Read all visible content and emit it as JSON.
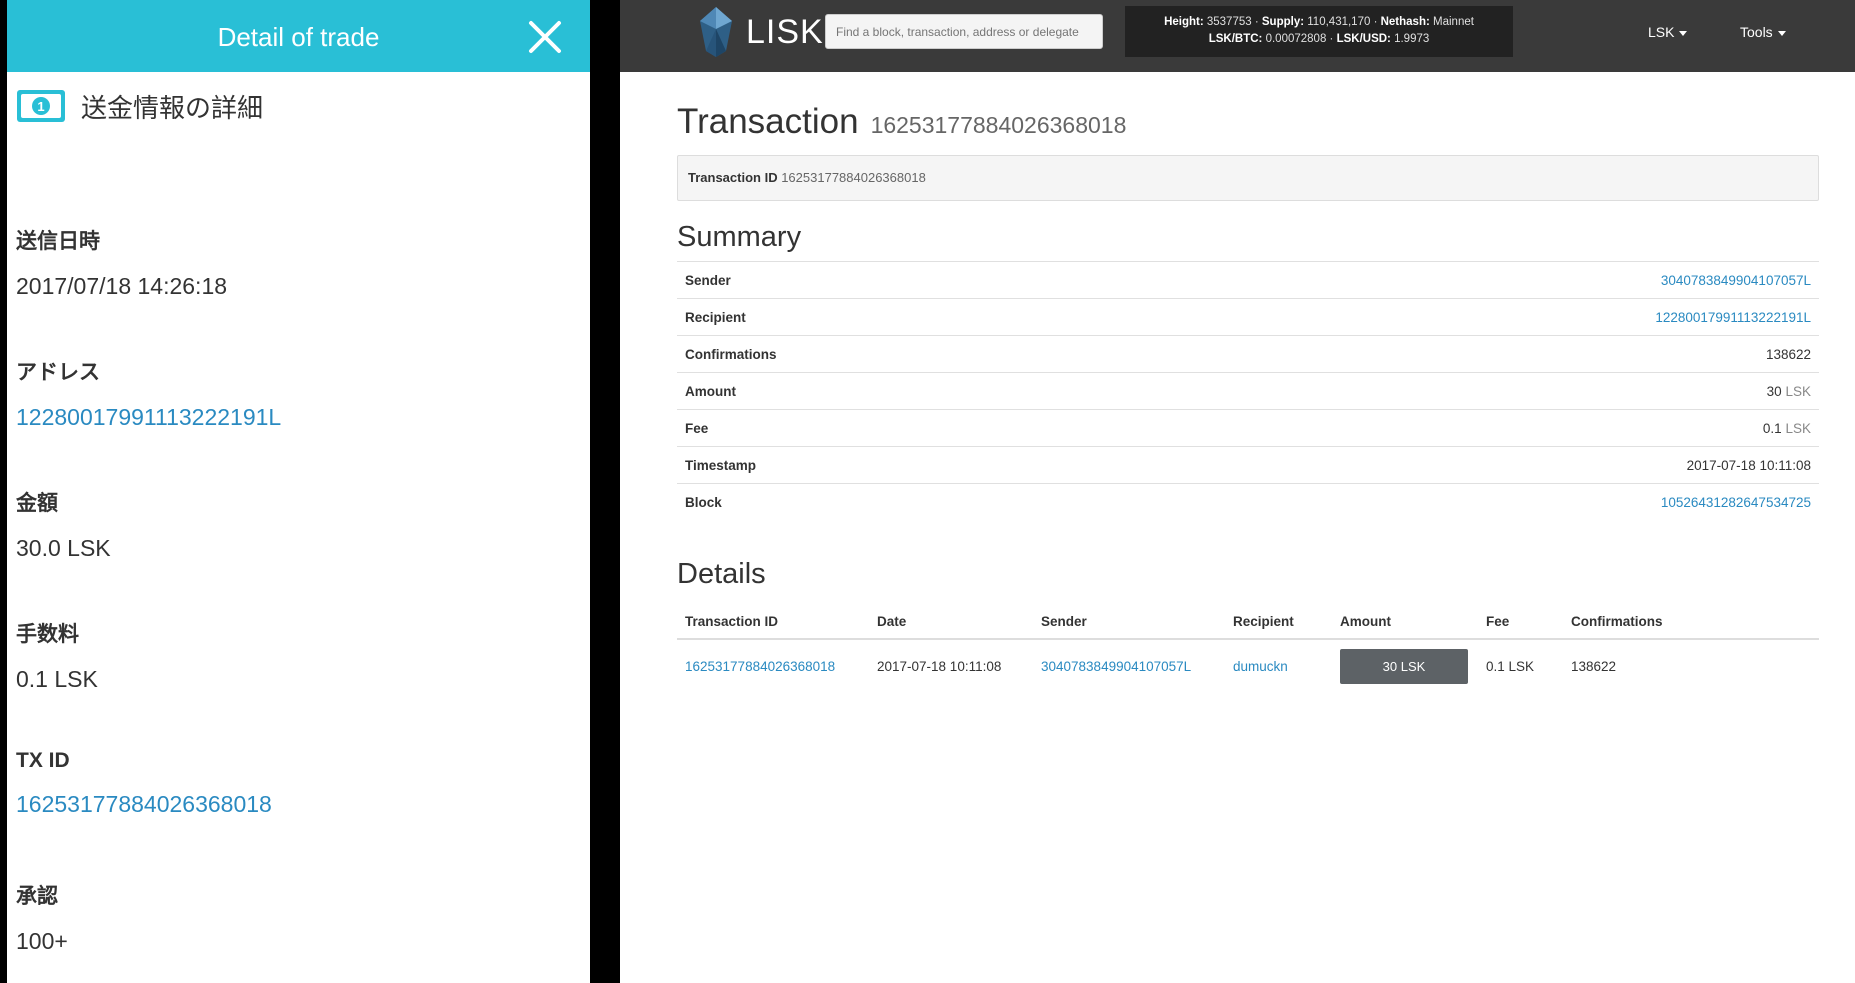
{
  "left": {
    "header_title": "Detail of trade",
    "section_title": "送金情報の詳細",
    "fields": [
      {
        "label": "送信日時",
        "value": "2017/07/18 14:26:18"
      },
      {
        "label": "アドレス",
        "value": "12280017991113222191L"
      },
      {
        "label": "金額",
        "value": "30.0 LSK"
      },
      {
        "label": "手数料",
        "value": "0.1 LSK"
      },
      {
        "label": "TX ID",
        "value": "16253177884026368018"
      },
      {
        "label": "承認",
        "value": "100+"
      }
    ]
  },
  "right": {
    "logo_text": "LISK",
    "search_placeholder": "Find a block, transaction, address or delegate",
    "stats": {
      "height_label": "Height:",
      "height": "3537753",
      "supply_label": "Supply:",
      "supply": "110,431,170",
      "nethash_label": "Nethash:",
      "nethash": "Mainnet",
      "btc_label": "LSK/BTC:",
      "btc": "0.00072808",
      "usd_label": "LSK/USD:",
      "usd": "1.9973"
    },
    "nav": {
      "lsk": "LSK",
      "tools": "Tools"
    },
    "title": "Transaction",
    "title_id": "16253177884026368018",
    "id_label": "Transaction ID",
    "id_value": "16253177884026368018",
    "summary_title": "Summary",
    "summary": [
      {
        "key": "Sender",
        "value": "3040783849904107057L",
        "unit": ""
      },
      {
        "key": "Recipient",
        "value": "12280017991113222191L",
        "unit": ""
      },
      {
        "key": "Confirmations",
        "value": "138622",
        "unit": ""
      },
      {
        "key": "Amount",
        "value": "30",
        "unit": "LSK"
      },
      {
        "key": "Fee",
        "value": "0.1",
        "unit": "LSK"
      },
      {
        "key": "Timestamp",
        "value": "2017-07-18 10:11:08",
        "unit": ""
      },
      {
        "key": "Block",
        "value": "10526431282647534725",
        "unit": ""
      }
    ],
    "details_title": "Details",
    "details_headers": [
      "Transaction ID",
      "Date",
      "Sender",
      "Recipient",
      "Amount",
      "Fee",
      "Confirmations"
    ],
    "details_row": {
      "tx_id": "16253177884026368018",
      "date": "2017-07-18 10:11:08",
      "sender": "3040783849904107057L",
      "recipient": "dumuckn",
      "amount": "30 LSK",
      "fee": "0.1 LSK",
      "confirmations": "138622"
    }
  },
  "colors": {
    "header_teal": "#29bfd6",
    "link_blue": "#2a8ac1",
    "topbar": "#3a3a3a",
    "confirm_green": "#3c8c3c"
  }
}
